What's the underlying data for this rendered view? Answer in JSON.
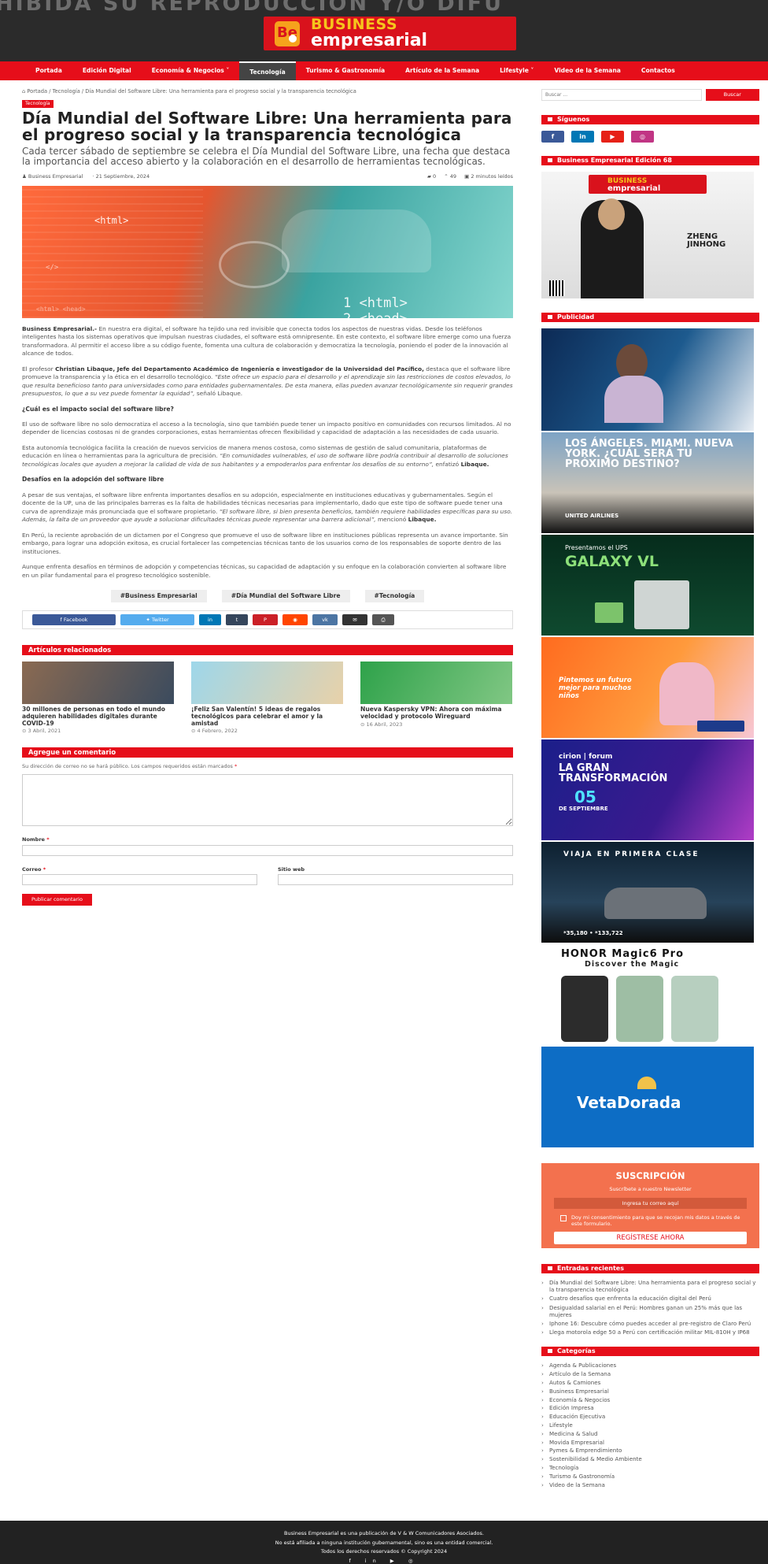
{
  "header": {
    "watermark": "HIBIDA SU REPRODUCCIÓN Y/O DIFU",
    "logo_mark": "Be",
    "logo_line1": "BUSINESS",
    "logo_line2": "empresarial"
  },
  "nav": [
    "Portada",
    "Edición Digital",
    "Economía & Negocios ˅",
    "Tecnología",
    "Turismo & Gastronomía",
    "Artículo de la Semana",
    "Lifestyle ˅",
    "Video de la Semana",
    "Contactos"
  ],
  "article": {
    "breadcrumb": "⌂ Portada / Tecnología / Día Mundial del Software Libre: Una herramienta para el progreso social y la transparencia tecnológica",
    "category": "Tecnología",
    "title": "Día Mundial del Software Libre: Una herramienta para el progreso social y la transparencia tecnológica",
    "subtitle": "Cada tercer sábado de septiembre se celebra el Día Mundial del Software Libre, una fecha que destaca la importancia del acceso abierto y la colaboración en el desarrollo de herramientas tecnológicas.",
    "author": "♟ Business Empresarial",
    "date": "· 21 Septiembre, 2024",
    "comments": "▰ 0",
    "views": "⌃ 49",
    "read_time": "▣ 2 minutos leídos",
    "hero_code": [
      "<html>",
      "</>",
      "1 <html>",
      "2 <head>",
      "<html> <head>"
    ],
    "p1_lead": "Business Empresarial.-",
    "p1": " En nuestra era digital, el software ha tejido una red invisible que conecta todos los aspectos de nuestras vidas. Desde los teléfonos inteligentes hasta los sistemas operativos que impulsan nuestras ciudades, el software está omnipresente. En este contexto, el software libre emerge como una fuerza transformadora. Al permitir el acceso libre a su código fuente, fomenta una cultura de colaboración y democratiza la tecnología, poniendo el poder de la innovación al alcance de todos.",
    "p2_a": "El profesor ",
    "p2_b": "Christian Libaque, Jefe del Departamento Académico de Ingeniería e investigador de la Universidad del Pacífico,",
    "p2_c": " destaca que el software libre promueve la transparencia y la ética en el desarrollo tecnológico. ",
    "p2_d": "“Este ofrece un espacio para el desarrollo y el aprendizaje sin las restricciones de costos elevados, lo que resulta beneficioso tanto para universidades como para entidades gubernamentales. De esta manera, ellas pueden avanzar tecnológicamente sin requerir grandes presupuestos, lo que a su vez puede fomentar la equidad”,",
    "p2_e": " señaló Libaque.",
    "h1": "¿Cuál es el impacto social del software libre?",
    "p3": "El uso de software libre no solo democratiza el acceso a la tecnología, sino que también puede tener un impacto positivo en comunidades con recursos limitados. Al no depender de licencias costosas ni de grandes corporaciones, estas herramientas ofrecen flexibilidad y capacidad de adaptación a las necesidades de cada usuario.",
    "p4_a": "Esta autonomía tecnológica facilita la creación de nuevos servicios de manera menos costosa, como sistemas de gestión de salud comunitaria, plataformas de educación en línea o herramientas para la agricultura de precisión. ",
    "p4_b": "“En comunidades vulnerables, el uso de software libre podría contribuir al desarrollo de soluciones tecnológicas locales que ayuden a mejorar la calidad de vida de sus habitantes y a empoderarlos para enfrentar los desafíos de su entorno”,",
    "p4_c": " enfatizó ",
    "p4_d": "Libaque.",
    "h2": "Desafíos en la adopción del software libre",
    "p5_a": "A pesar de sus ventajas, el software libre enfrenta importantes desafíos en su adopción, especialmente en instituciones educativas y gubernamentales. Según el docente de la UP, una de las principales barreras es la falta de habilidades técnicas necesarias para implementarlo, dado que este tipo de software puede tener una curva de aprendizaje más pronunciada que el software propietario. ",
    "p5_b": "“El software libre, si bien presenta beneficios, también requiere habilidades específicas para su uso. Además, la falta de un proveedor que ayude a solucionar dificultades técnicas puede representar una barrera adicional”,",
    "p5_c": " mencionó ",
    "p5_d": "Libaque.",
    "p6": "En Perú, la reciente aprobación de un dictamen por el Congreso que promueve el uso de software libre en instituciones públicas representa un avance importante. Sin embargo, para lograr una adopción exitosa, es crucial fortalecer las competencias técnicas tanto de los usuarios como de los responsables de soporte dentro de las instituciones.",
    "p7": "Aunque enfrenta desafíos en términos de adopción y competencias técnicas, su capacidad de adaptación y su enfoque en la colaboración convierten al software libre en un pilar fundamental para el progreso tecnológico sostenible.",
    "tags": [
      "#Business Empresarial",
      "#Día Mundial del Software Libre",
      "#Tecnología"
    ]
  },
  "share": [
    {
      "label": "f   Facebook",
      "color": "#3b5998",
      "w": 106
    },
    {
      "label": "✦   Twitter",
      "color": "#55acee",
      "w": 94
    },
    {
      "label": "in",
      "color": "#0077b5",
      "w": 28
    },
    {
      "label": "t",
      "color": "#35465c",
      "w": 28
    },
    {
      "label": "P",
      "color": "#cb2027",
      "w": 32
    },
    {
      "label": "◉",
      "color": "#ff4500",
      "w": 32
    },
    {
      "label": "vk",
      "color": "#4c75a3",
      "w": 32
    },
    {
      "label": "✉",
      "color": "#333333",
      "w": 32
    },
    {
      "label": "⎙",
      "color": "#555555",
      "w": 28
    }
  ],
  "related": {
    "heading": "Artículos relacionados",
    "items": [
      {
        "title": "30 millones de personas en todo el mundo adquieren habilidades digitales durante COVID-19",
        "date": "⊙ 3 Abril, 2021",
        "c1": "#8a6a52",
        "c2": "#3b4b5e"
      },
      {
        "title": "¡Feliz San Valentín! 5 ideas de regalos tecnológicos para celebrar el amor y la amistad",
        "date": "⊙ 4 Febrero, 2022",
        "c1": "#9ed7ea",
        "c2": "#e8d1a9"
      },
      {
        "title": "Nueva Kaspersky VPN: Ahora con máxima velocidad y protocolo Wireguard",
        "date": "⊙ 16 Abril, 2023",
        "c1": "#2ea24a",
        "c2": "#81c784"
      }
    ]
  },
  "comment": {
    "heading": "Agregue un comentario",
    "note": "Su dirección de correo no se hará público. Los campos requeridos están marcados",
    "star": "*",
    "name": "Nombre",
    "email": "Correo",
    "website": "Sitio web",
    "submit": "Publicar comentario"
  },
  "sidebar": {
    "search_placeholder": "Buscar ...",
    "search_btn": "Buscar",
    "follow": "Síguenos",
    "social": [
      {
        "label": "f",
        "color": "#3b5998"
      },
      {
        "label": "in",
        "color": "#0077b5"
      },
      {
        "label": "▶",
        "color": "#e62117"
      },
      {
        "label": "◎",
        "color": "#c13584"
      }
    ],
    "edition": "Business Empresarial Edición 68",
    "cover_name": "ZHENG JINHONG",
    "ads_heading": "Publicidad",
    "ad_united": "LOS ÁNGELES. MIAMI. NUEVA YORK. ¿CUÁL SERÁ TU PRÓXIMO DESTINO?",
    "ad_united_brand": "UNITED AIRLINES",
    "ad_galaxy_pre": "Presentamos el UPS",
    "ad_galaxy": "GALAXY VL",
    "ad_bcp": "Pintemos un futuro mejor para muchos niños",
    "ad_cirion_brand": "cirion | forum",
    "ad_cirion": "LA GRAN TRANSFORMACIÓN",
    "ad_cirion_date": "05",
    "ad_cirion_month": "DE SEPTIEMBRE",
    "ad_chery": "VIAJA EN PRIMERA CLASE",
    "ad_chery_prices": "*35,180 • *133,722",
    "ad_honor": "HONOR Magic6 Pro",
    "ad_honor_sub": "Discover the Magic",
    "ad_veta": "VetaDorada",
    "sub_title": "SUSCRIPCIÓN",
    "sub_sub": "Suscríbete a nuestro Newsletter",
    "sub_input": "Ingresa tu correo aquí",
    "sub_consent": "Doy mi consentimiento para que se recojan mis datos a través de este formulario.",
    "sub_btn": "REGÍSTRESE AHORA",
    "recent_heading": "Entradas recientes",
    "recent": [
      "Día Mundial del Software Libre: Una herramienta para el progreso social y la transparencia tecnológica",
      "Cuatro desafíos que enfrenta la educación digital del Perú",
      "Desigualdad salarial en el Perú: Hombres ganan un 25% más que las mujeres",
      "Iphone 16: Descubre cómo puedes acceder al pre-registro de Claro Perú",
      "Llega motorola edge 50 a Perú con certificación militar MIL-810H y IP68"
    ],
    "cat_heading": "Categorías",
    "categories": [
      "Agenda & Publicaciones",
      "Artículo de la Semana",
      "Autos & Camiones",
      "Business Empresarial",
      "Economía & Negocios",
      "Edición Impresa",
      "Educación Ejecutiva",
      "Lifestyle",
      "Medicina & Salud",
      "Movida Empresarial",
      "Pymes & Emprendimiento",
      "Sostenibilidad & Medio Ambiente",
      "Tecnología",
      "Turismo & Gastronomía",
      "Video de la Semana"
    ]
  },
  "footer": {
    "line1": "Business Empresarial es una publicación de V & W Comunicadores Asociados.",
    "line2": "No está afiliada a ninguna institución gubernamental, sino es una entidad comercial.",
    "line3": "Todos los derechos reservados © Copyright 2024",
    "icons": "f in ▶ ◎"
  }
}
